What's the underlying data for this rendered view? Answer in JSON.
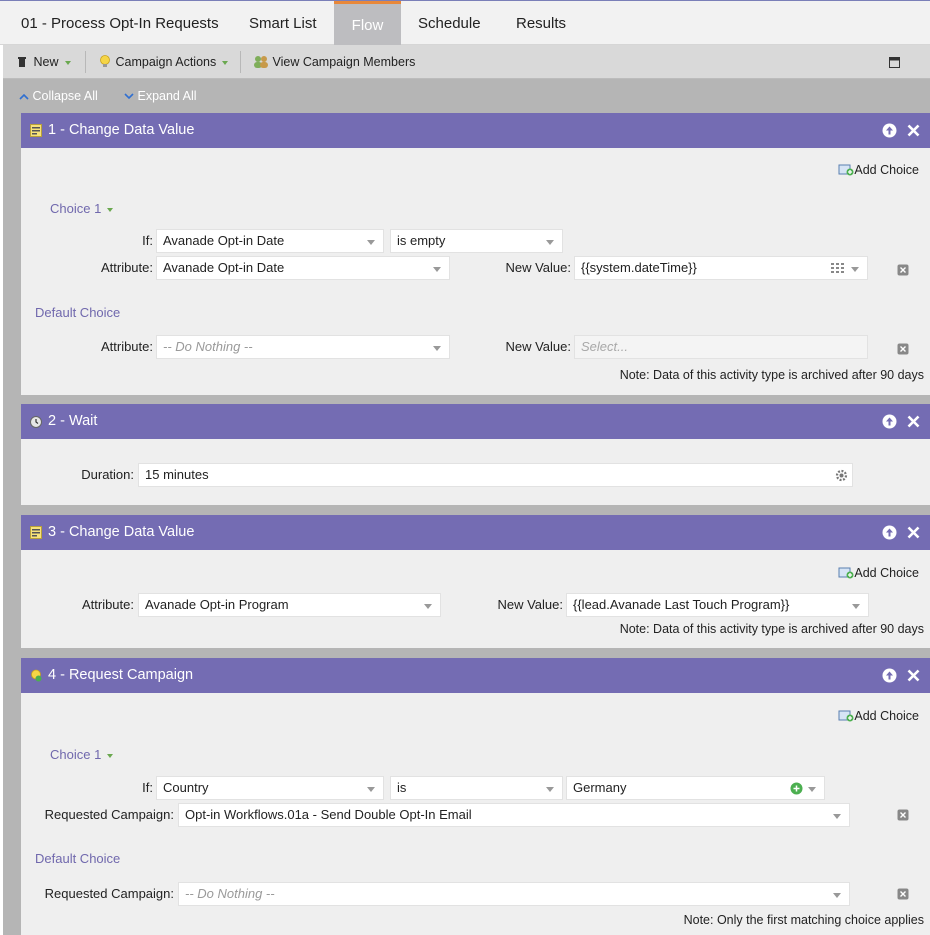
{
  "tabs": [
    {
      "label": "01 - Process Opt-In Requests"
    },
    {
      "label": "Smart List"
    },
    {
      "label": "Flow",
      "active": true
    },
    {
      "label": "Schedule"
    },
    {
      "label": "Results"
    }
  ],
  "toolbar": {
    "new_label": "New",
    "campaign_actions_label": "Campaign Actions",
    "view_members_label": "View Campaign Members"
  },
  "canvas": {
    "collapse_all": "Collapse All",
    "expand_all": "Expand All"
  },
  "steps": [
    {
      "title": "1 - Change Data Value",
      "add_choice": "Add Choice",
      "choice_label": "Choice 1",
      "if_label": "If:",
      "if_field": "Avanade Opt-in Date",
      "if_operator": "is empty",
      "attribute_label": "Attribute:",
      "attribute_value": "Avanade Opt-in Date",
      "new_value_label": "New Value:",
      "new_value": "{{system.dateTime}}",
      "default_choice": "Default Choice",
      "default_attribute_label": "Attribute:",
      "default_attribute_value": "-- Do Nothing --",
      "default_new_value_label": "New Value:",
      "default_new_value_placeholder": "Select...",
      "note": "Note: Data of this activity type is archived after 90 days"
    },
    {
      "title": "2 - Wait",
      "duration_label": "Duration:",
      "duration_value": "15 minutes"
    },
    {
      "title": "3 - Change Data Value",
      "add_choice": "Add Choice",
      "attribute_label": "Attribute:",
      "attribute_value": "Avanade Opt-in Program",
      "new_value_label": "New Value:",
      "new_value": "{{lead.Avanade Last Touch Program}}",
      "note": "Note: Data of this activity type is archived after 90 days"
    },
    {
      "title": "4 - Request Campaign",
      "add_choice": "Add Choice",
      "choice_label": "Choice 1",
      "if_label": "If:",
      "if_field": "Country",
      "if_operator": "is",
      "if_value": "Germany",
      "requested_label": "Requested Campaign:",
      "requested_value": "Opt-in Workflows.01a - Send Double Opt-In Email",
      "default_choice": "Default Choice",
      "default_requested_label": "Requested Campaign:",
      "default_requested_value": "-- Do Nothing --",
      "note": "Note: Only the first matching choice applies"
    }
  ],
  "colors": {
    "step_header": "#746cb3",
    "section_text": "#7068ad",
    "active_tab_border": "#e8883a",
    "accent_green": "#6aa84f"
  }
}
